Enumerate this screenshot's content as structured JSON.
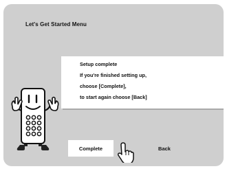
{
  "menu": {
    "title": "Let's Get Started Menu"
  },
  "message": {
    "lines": [
      "Setup complete",
      "If you're finished setting up,",
      "choose [Complete],",
      "to start again choose [Back]"
    ]
  },
  "buttons": {
    "complete_label": "Complete",
    "back_label": "Back",
    "selected": "Complete"
  },
  "icons": {
    "mascot": "remote-control-mascot-icon",
    "pointer": "hand-pointer-icon"
  },
  "colors": {
    "screen_background": "#cfcfcf",
    "panel": "#ffffff",
    "text": "#111111"
  }
}
